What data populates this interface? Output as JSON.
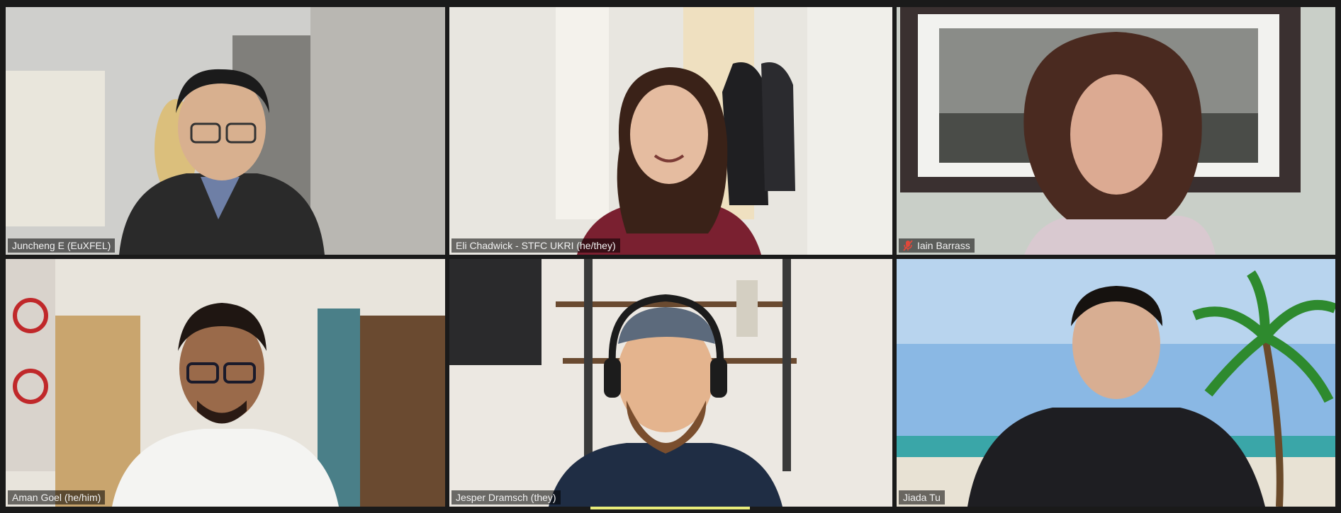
{
  "participants": [
    {
      "name": "Juncheng E (EuXFEL)",
      "muted": false,
      "active": false
    },
    {
      "name": "Eli Chadwick - STFC UKRI (he/they)",
      "muted": false,
      "active": true
    },
    {
      "name": "Iain Barrass",
      "muted": true,
      "active": false
    },
    {
      "name": "Aman Goel (he/him)",
      "muted": false,
      "active": false
    },
    {
      "name": "Jesper Dramsch (they)",
      "muted": false,
      "active": false
    },
    {
      "name": "Jiada Tu",
      "muted": false,
      "active": false
    }
  ],
  "icons": {
    "mute": "microphone-muted-icon"
  },
  "colors": {
    "active_border": "#e8ec7a",
    "mute_icon": "#e0483a",
    "label_bg": "rgba(0,0,0,0.55)"
  }
}
